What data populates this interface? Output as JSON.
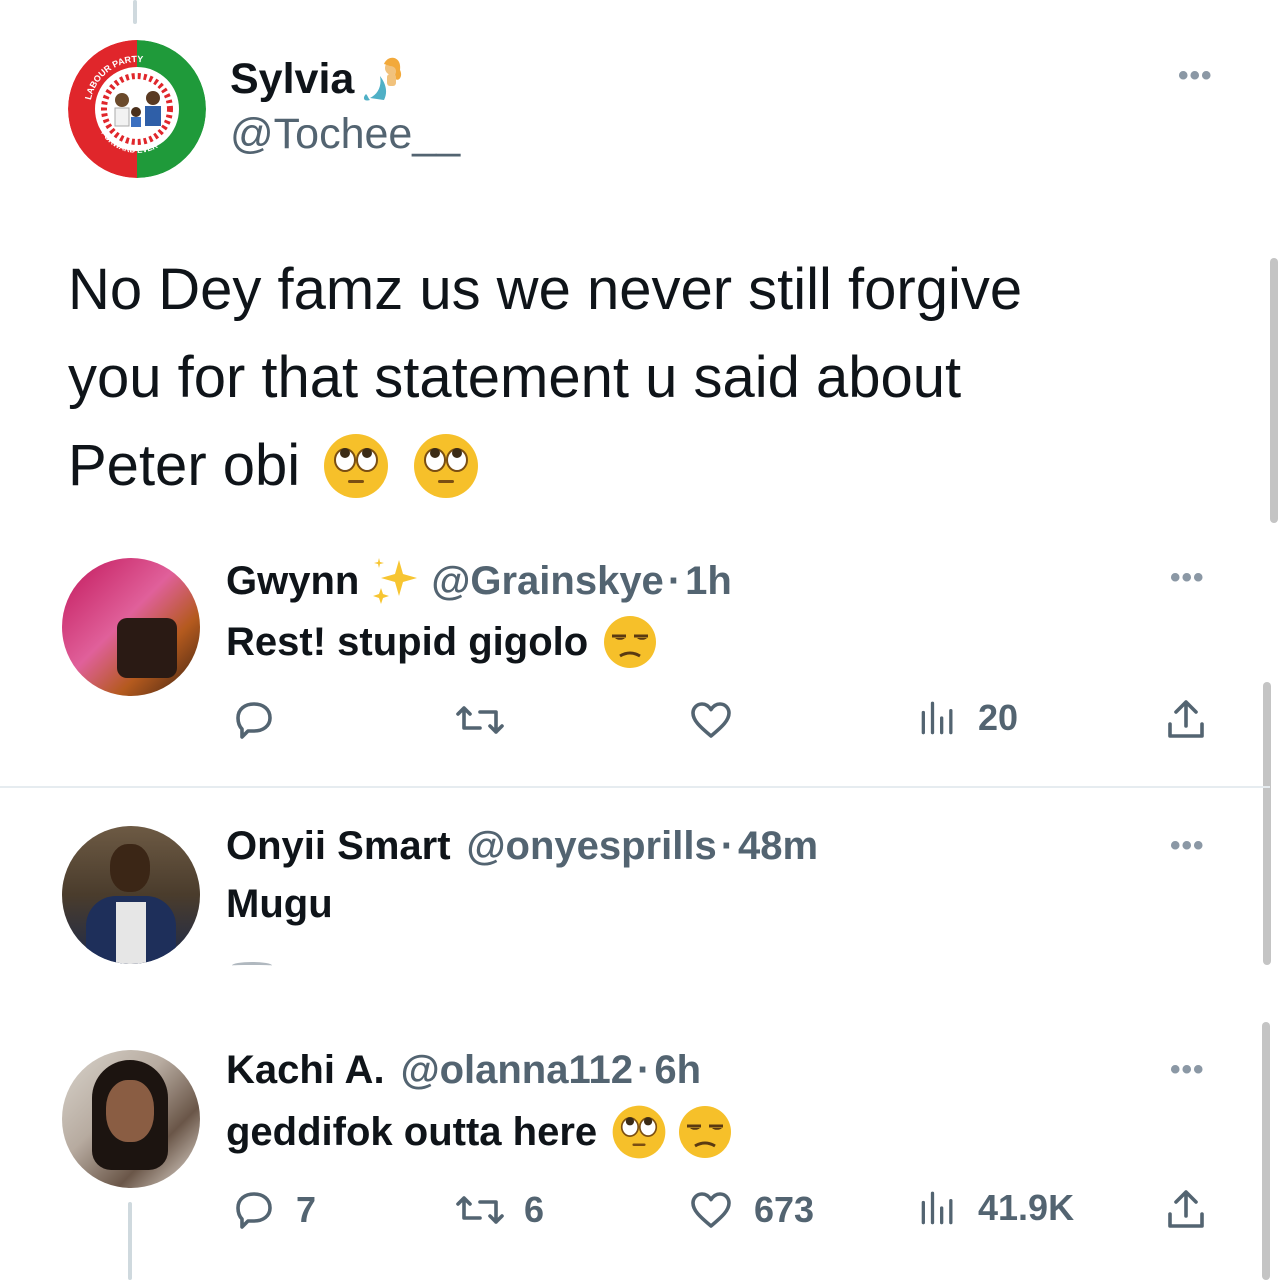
{
  "main_tweet": {
    "display_name": "Sylvia",
    "handle": "@Tochee__",
    "avatar_text": {
      "top": "LABOUR PARTY",
      "bottom": "FORWARD EVER"
    },
    "text_lines": [
      "No Dey famz us we never still forgive",
      "you for that statement u said about",
      "Peter obi"
    ],
    "emoji": [
      "face-with-rolling-eyes",
      "face-with-rolling-eyes"
    ]
  },
  "replies": [
    {
      "display_name": "Gwynn",
      "name_emoji": "sparkles",
      "handle": "@Grainskye",
      "separator": "·",
      "time": "1h",
      "text": "Rest! stupid gigolo",
      "emoji": [
        "unamused-face"
      ],
      "actions": {
        "reply": "",
        "retweet": "",
        "like": "",
        "views": "20"
      }
    },
    {
      "display_name": "Onyii Smart",
      "handle": "@onyesprills",
      "separator": "·",
      "time": "48m",
      "text": "Mugu"
    },
    {
      "display_name": "Kachi A.",
      "handle": "@olanna112",
      "separator": "·",
      "time": "6h",
      "text": "geddifok outta here",
      "emoji": [
        "face-with-rolling-eyes",
        "unamused-face"
      ],
      "actions": {
        "reply": "7",
        "retweet": "6",
        "like": "673",
        "views": "41.9K"
      }
    }
  ],
  "colors": {
    "text": "#0f1419",
    "secondary": "#536471",
    "labour_red": "#e0262b",
    "labour_green": "#1f9a3a"
  }
}
